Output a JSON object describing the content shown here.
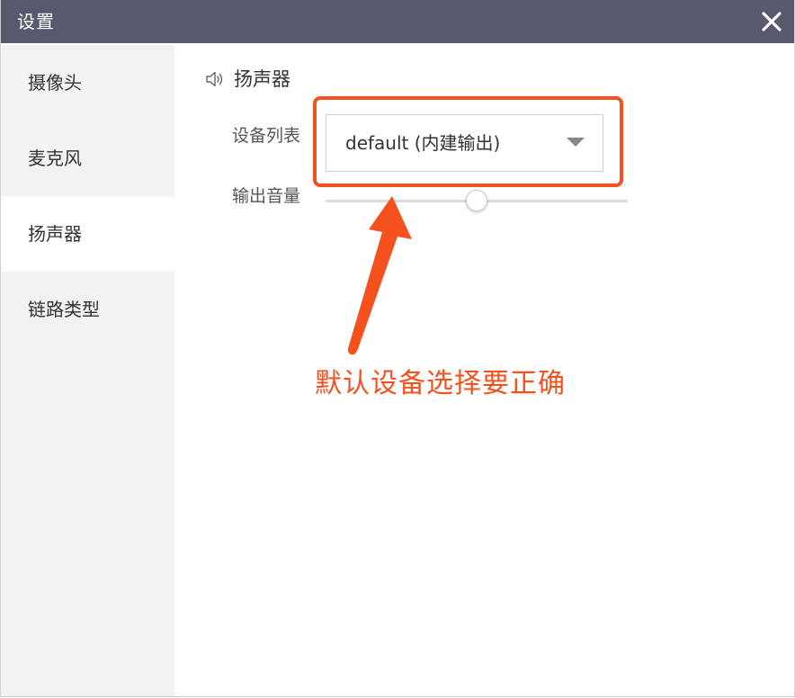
{
  "window": {
    "title": "设置"
  },
  "sidebar": {
    "items": [
      {
        "label": "摄像头",
        "active": false
      },
      {
        "label": "麦克风",
        "active": false
      },
      {
        "label": "扬声器",
        "active": true
      },
      {
        "label": "链路类型",
        "active": false
      }
    ]
  },
  "speaker": {
    "section_title": "扬声器",
    "device_list_label": "设备列表",
    "device_selected": "default (内建输出)",
    "output_volume_label": "输出音量",
    "volume_fraction": 0.5
  },
  "annotation": {
    "text": "默认设备选择要正确",
    "color": "#f4511e"
  },
  "icons": {
    "close": "close-icon",
    "speaker": "speaker-icon",
    "dropdown": "caret-down-icon"
  },
  "colors": {
    "titlebar": "#575a6e",
    "sidebar": "#f2f2f2",
    "highlight": "#f4511e"
  }
}
